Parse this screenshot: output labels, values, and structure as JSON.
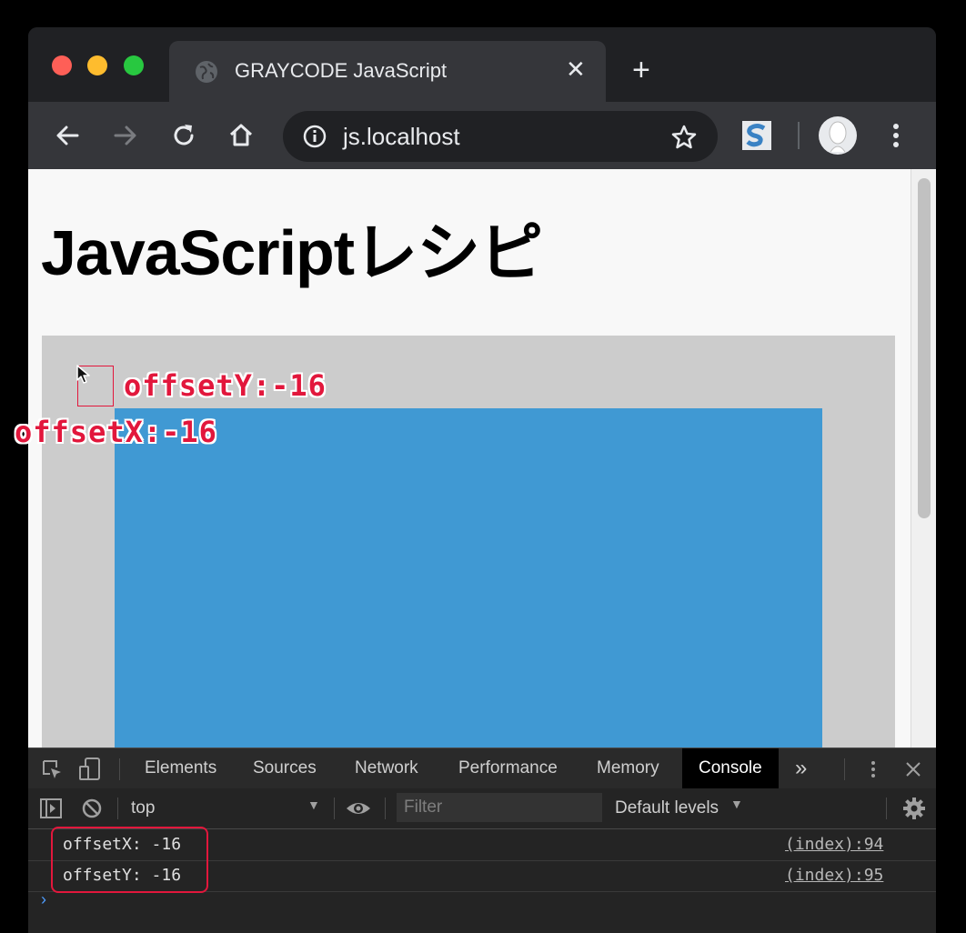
{
  "window": {
    "traffic_lights": [
      "#fe5f57",
      "#febc2e",
      "#28c840"
    ]
  },
  "tab": {
    "title": "GRAYCODE JavaScript",
    "icon": "globe-icon",
    "close_glyph": "✕",
    "new_tab_glyph": "+"
  },
  "toolbar": {
    "url": "js.localhost",
    "buttons": [
      "back-icon",
      "forward-icon",
      "reload-icon",
      "home-icon",
      "info-icon",
      "star-icon",
      "extension-s-icon",
      "profile-icon",
      "menu-icon"
    ]
  },
  "page": {
    "heading": "JavaScriptレシピ",
    "colors": {
      "outer_box": "#cccccc",
      "inner_box": "#4099d3"
    }
  },
  "annotations": {
    "offset_y": "offsetY:-16",
    "offset_x": "offsetX:-16",
    "color": "#e2173c"
  },
  "devtools": {
    "tabs": [
      "Elements",
      "Sources",
      "Network",
      "Performance",
      "Memory",
      "Console"
    ],
    "active_tab": "Console",
    "more_glyph": "»",
    "context": "top",
    "filter_placeholder": "Filter",
    "levels": "Default levels",
    "logs": [
      {
        "text": "offsetX: -16",
        "source": "(index):94"
      },
      {
        "text": "offsetY: -16",
        "source": "(index):95"
      }
    ],
    "prompt_glyph": "›"
  }
}
